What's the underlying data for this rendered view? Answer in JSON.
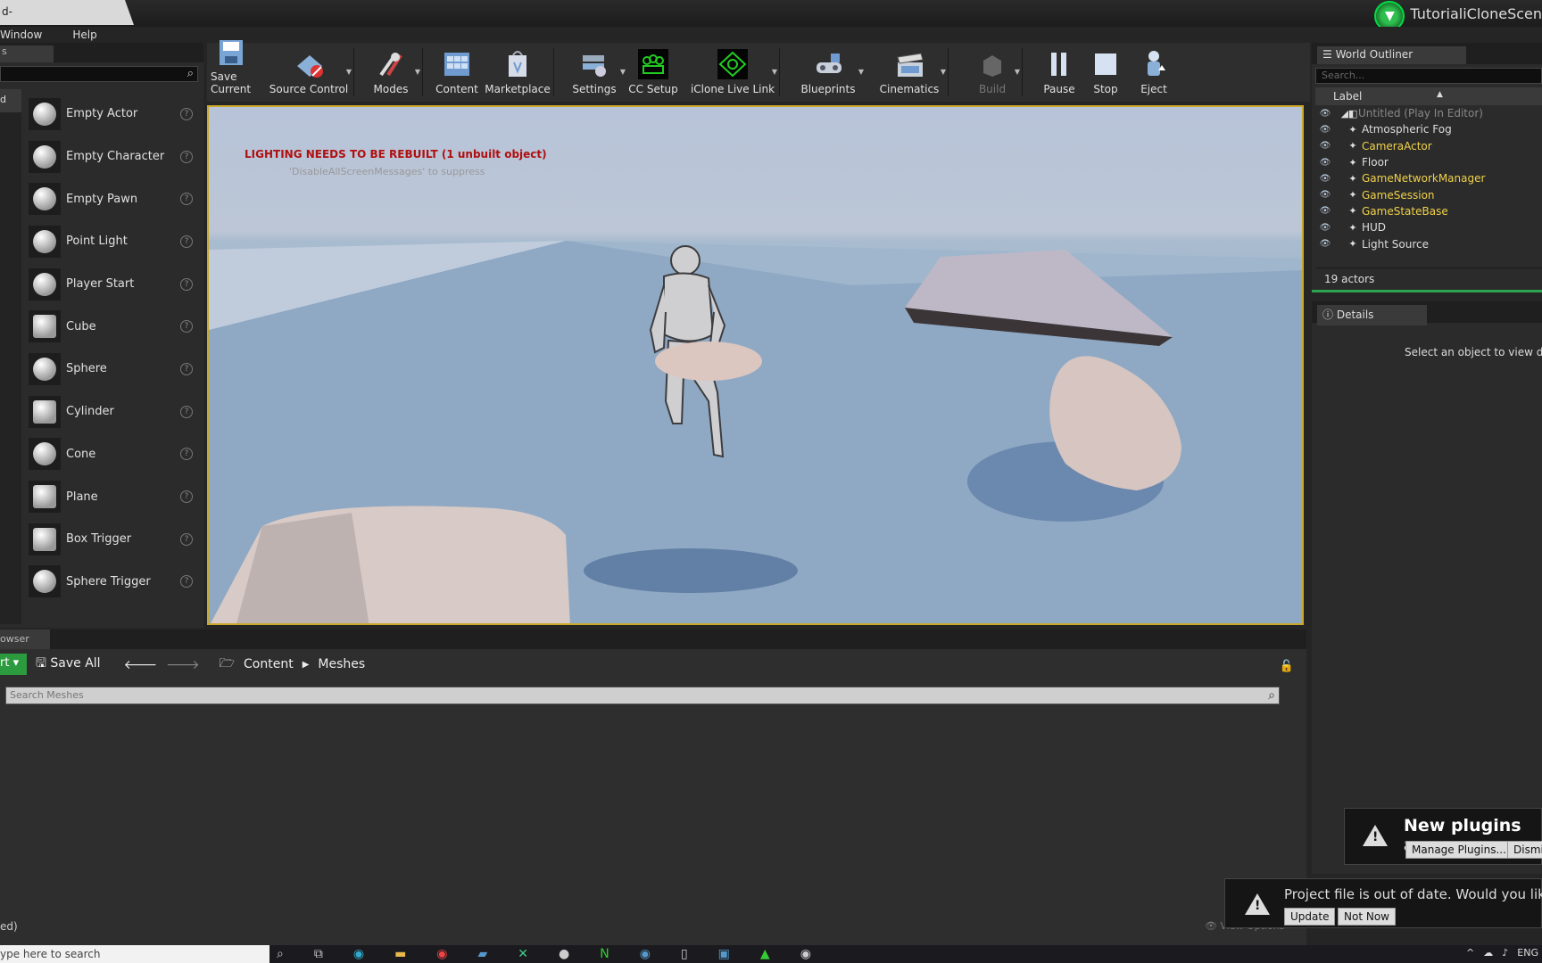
{
  "titlebar": {
    "tab_stub": "d-",
    "project_name": "TutorialiCloneScen"
  },
  "menu": [
    "Window",
    "Help"
  ],
  "left_panel": {
    "tab_stub": "s",
    "category_stub": "d",
    "items": [
      {
        "label": "Empty Actor",
        "icon": "sphere-icon"
      },
      {
        "label": "Empty Character",
        "icon": "character-icon"
      },
      {
        "label": "Empty Pawn",
        "icon": "pawn-icon"
      },
      {
        "label": "Point Light",
        "icon": "point-light-icon"
      },
      {
        "label": "Player Start",
        "icon": "player-start-icon"
      },
      {
        "label": "Cube",
        "icon": "cube-icon"
      },
      {
        "label": "Sphere",
        "icon": "sphere-icon"
      },
      {
        "label": "Cylinder",
        "icon": "cylinder-icon"
      },
      {
        "label": "Cone",
        "icon": "cone-icon"
      },
      {
        "label": "Plane",
        "icon": "plane-icon"
      },
      {
        "label": "Box Trigger",
        "icon": "box-trigger-icon"
      },
      {
        "label": "Sphere Trigger",
        "icon": "sphere-trigger-icon"
      }
    ],
    "help_glyph": "?"
  },
  "toolbar": {
    "save_current": "Save Current",
    "source_control": "Source Control",
    "modes": "Modes",
    "content": "Content",
    "marketplace": "Marketplace",
    "settings": "Settings",
    "cc_setup": "CC Setup",
    "iclone_live_link": "iClone Live Link",
    "blueprints": "Blueprints",
    "cinematics": "Cinematics",
    "build": "Build",
    "pause": "Pause",
    "stop": "Stop",
    "eject": "Eject"
  },
  "viewport": {
    "warning": "LIGHTING NEEDS TO BE REBUILT (1 unbuilt object)",
    "suppress_hint": "'DisableAllScreenMessages' to suppress"
  },
  "outliner": {
    "tab": "World Outliner",
    "search_placeholder": "Search...",
    "column": "Label",
    "root": "Untitled (Play In Editor)",
    "actors": [
      {
        "name": "Atmospheric Fog",
        "color": "white"
      },
      {
        "name": "CameraActor",
        "color": "yellow"
      },
      {
        "name": "Floor",
        "color": "white"
      },
      {
        "name": "GameNetworkManager",
        "color": "yellow"
      },
      {
        "name": "GameSession",
        "color": "yellow"
      },
      {
        "name": "GameStateBase",
        "color": "yellow"
      },
      {
        "name": "HUD",
        "color": "white"
      },
      {
        "name": "Light Source",
        "color": "white"
      }
    ],
    "count": "19 actors"
  },
  "details": {
    "tab": "Details",
    "empty_message": "Select an object to view deta"
  },
  "content_browser": {
    "tab_stub": "owser",
    "import_stub": "rt",
    "save_all": "Save All",
    "path": [
      "Content",
      "Meshes"
    ],
    "search_placeholder": "Search Meshes",
    "status": "ed)",
    "view_options": "View Options"
  },
  "notifications": {
    "plugins": {
      "title": "New plugins are",
      "manage": "Manage Plugins...",
      "dismiss": "Dismis"
    },
    "project": {
      "message": "Project file is out of date. Would you like",
      "update": "Update",
      "not_now": "Not Now"
    }
  },
  "taskbar": {
    "search": "ype here to search",
    "lang": "ENG"
  },
  "colors": {
    "accent_green": "#2ea44f",
    "viewport_border": "#c9a82a",
    "warning_red": "#b01010",
    "actor_yellow": "#f0d24a"
  }
}
